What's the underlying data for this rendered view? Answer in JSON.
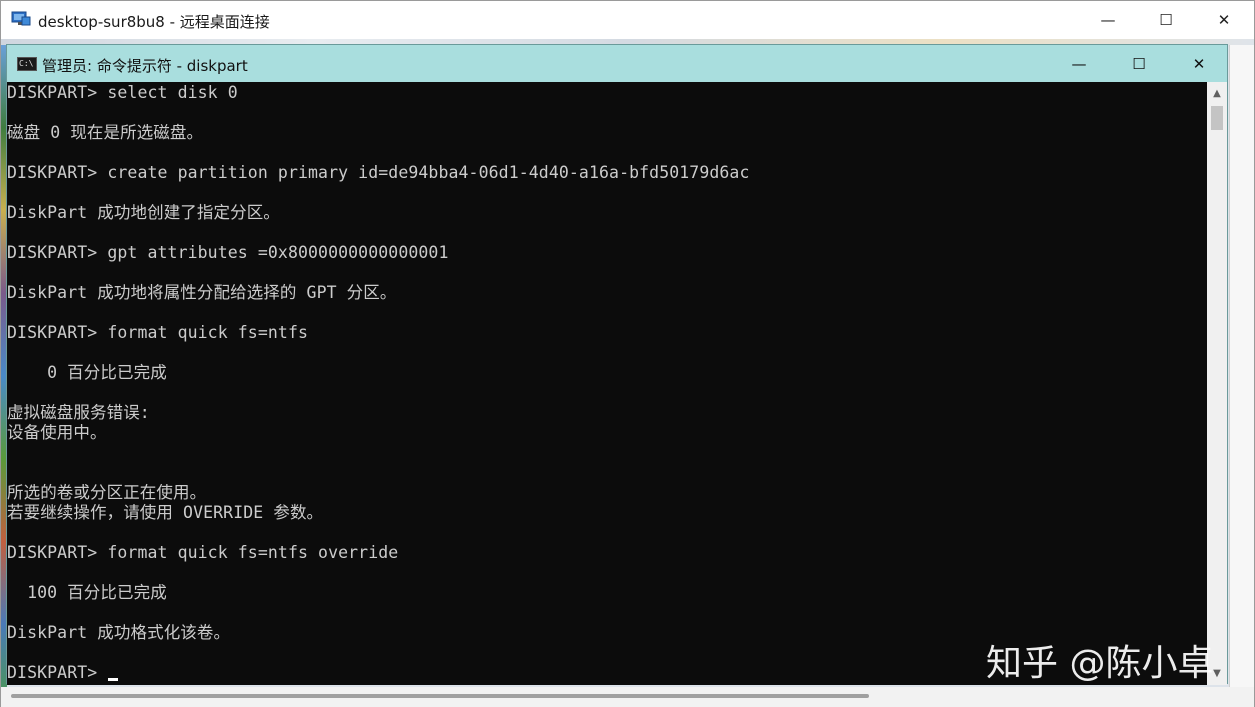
{
  "rdp_window": {
    "title": "desktop-sur8bu8 - 远程桌面连接",
    "minimize_glyph": "—",
    "maximize_glyph": "☐",
    "close_glyph": "✕",
    "icon": "remote-desktop-icon"
  },
  "cmd_window": {
    "title": "管理员: 命令提示符 - diskpart",
    "icon_text": "C:\\",
    "minimize_glyph": "—",
    "maximize_glyph": "☐",
    "close_glyph": "✕",
    "icon": "cmd-icon"
  },
  "console_lines": [
    "DISKPART> select disk 0",
    "",
    "磁盘 0 现在是所选磁盘。",
    "",
    "DISKPART> create partition primary id=de94bba4-06d1-4d40-a16a-bfd50179d6ac",
    "",
    "DiskPart 成功地创建了指定分区。",
    "",
    "DISKPART> gpt attributes =0x8000000000000001",
    "",
    "DiskPart 成功地将属性分配给选择的 GPT 分区。",
    "",
    "DISKPART> format quick fs=ntfs",
    "",
    "    0 百分比已完成",
    "",
    "虚拟磁盘服务错误:",
    "设备使用中。",
    "",
    "",
    "所选的卷或分区正在使用。",
    "若要继续操作，请使用 OVERRIDE 参数。",
    "",
    "DISKPART> format quick fs=ntfs override",
    "",
    "  100 百分比已完成",
    "",
    "DiskPart 成功格式化该卷。",
    "",
    "DISKPART> "
  ],
  "scrollbar": {
    "up_glyph": "▲",
    "down_glyph": "▼"
  },
  "watermark": "知乎 @陈小卓",
  "colors": {
    "console_bg": "#0c0c0c",
    "console_fg": "#cccccc",
    "cmd_titlebar": "#a9dede"
  }
}
